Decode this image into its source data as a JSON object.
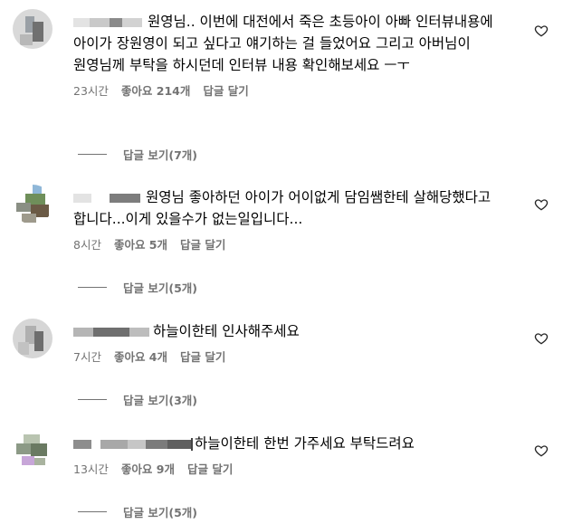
{
  "comments": [
    {
      "text": "원영님.. 이번에 대전에서 죽은 초등아이 아빠 인터뷰내용에 아이가 장원영이 되고 싶다고 얘기하는 걸 들었어요 그리고 아버님이 원영님께 부탁을 하시던데 인터뷰 내용 확인해보세요 ㅡㅜ",
      "time": "23시간",
      "likes": "좋아요 214개",
      "reply": "답글 달기",
      "view_replies": "답글 보기(7개)"
    },
    {
      "text": "원영님 좋아하던 아이가 어이없게 담임쌤한테 살해당했다고 합니다...이게 있을수가 없는일입니다...",
      "time": "8시간",
      "likes": "좋아요 5개",
      "reply": "답글 달기",
      "view_replies": "답글 보기(5개)"
    },
    {
      "text": "하늘이한테 인사해주세요",
      "time": "7시간",
      "likes": "좋아요 4개",
      "reply": "답글 달기",
      "view_replies": "답글 보기(3개)"
    },
    {
      "text": "하늘이한테 한번 가주세요 부탁드려요",
      "time": "13시간",
      "likes": "좋아요 9개",
      "reply": "답글 달기",
      "view_replies": "답글 보기(5개)"
    }
  ],
  "icons": {
    "like": "heart-outline-icon"
  },
  "colors": {
    "meta_text": "#737373",
    "body_text": "#000000",
    "background": "#ffffff"
  }
}
